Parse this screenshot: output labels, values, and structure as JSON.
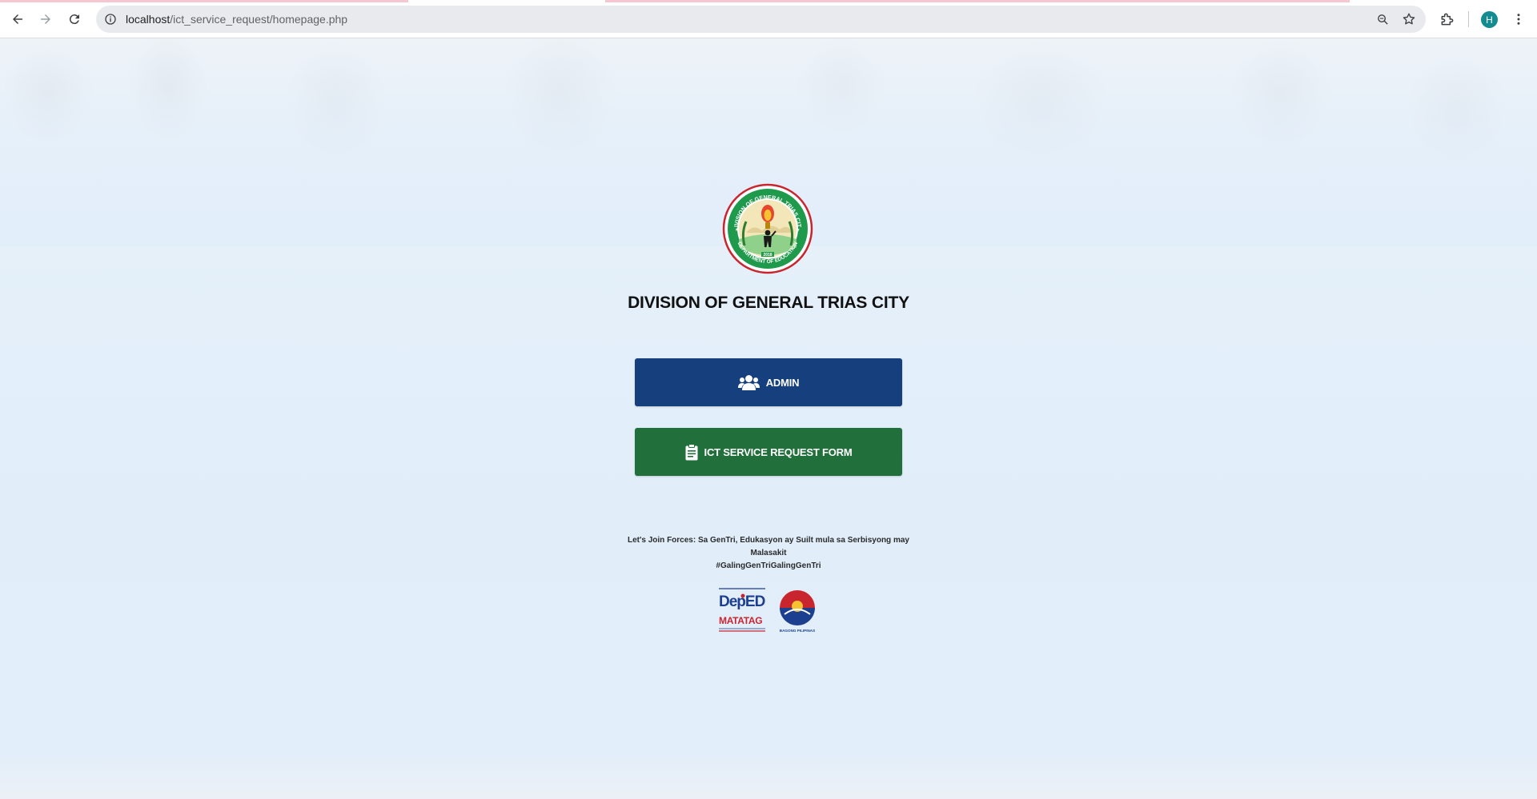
{
  "browser": {
    "url_host": "localhost",
    "url_path": "/ict_service_request/homepage.php",
    "profile_initial": "H",
    "icons": {
      "back": "arrow-left-icon",
      "forward": "arrow-right-icon",
      "reload": "reload-icon",
      "site_info": "info-icon",
      "zoom": "zoom-icon",
      "bookmark": "star-icon",
      "extensions": "puzzle-icon",
      "menu": "kebab-menu-icon"
    }
  },
  "page": {
    "seal_text_top": "DIVISION OF GENERAL TRIAS CITY",
    "seal_text_bottom": "DEPARTMENT OF EDUCATION",
    "seal_year": "2018",
    "title": "DIVISION OF GENERAL TRIAS CITY",
    "admin_button": {
      "label": "ADMIN",
      "icon": "users-icon"
    },
    "ict_button": {
      "label": "ICT SERVICE REQUEST FORM",
      "icon": "clipboard-icon"
    },
    "slogan_line1": "Let's Join Forces: Sa GenTri, Edukasyon ay Suilt mula sa Serbisyong may",
    "slogan_line2": "Malasakit",
    "hashtag": "#GalingGenTriGalingGenTri",
    "logo_deped_top": "DepED",
    "logo_deped_bottom": "MATATAG",
    "logo_bagong": "BAGONG PILIPINAS"
  },
  "colors": {
    "admin_button": "#163f7d",
    "ict_button": "#21703b",
    "page_bg": "#e3f0fb",
    "avatar": "#128b91"
  }
}
